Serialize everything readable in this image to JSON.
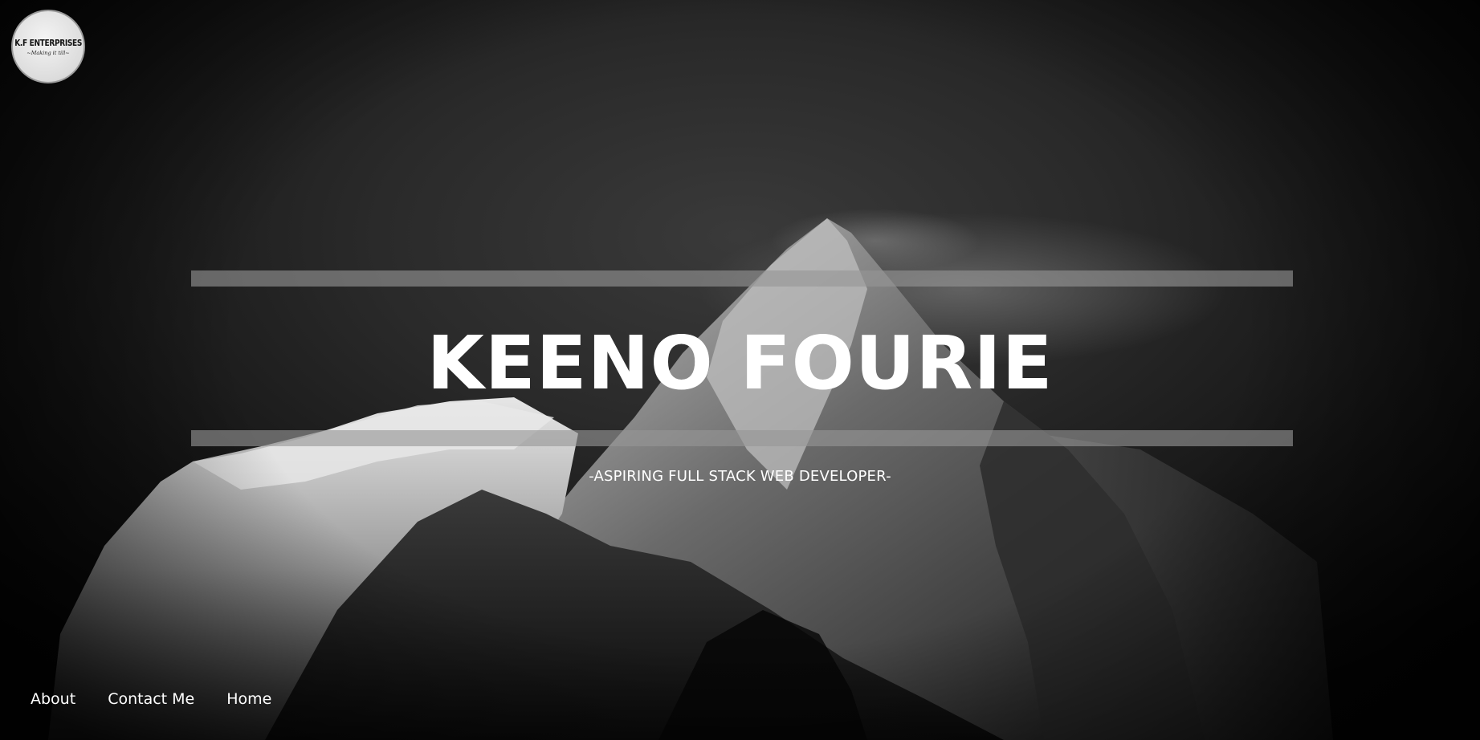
{
  "logo": {
    "title": "K.F ENTERPRISES",
    "tagline": "~Making it till~"
  },
  "hero": {
    "title": "KEENO FOURIE",
    "subtitle": "-ASPIRING FULL STACK WEB DEVELOPER-"
  },
  "nav": {
    "items": [
      {
        "label": "About"
      },
      {
        "label": "Contact Me"
      },
      {
        "label": "Home"
      }
    ]
  },
  "colors": {
    "text": "#ffffff",
    "bar": "#969696",
    "background": "#2a2a2a"
  }
}
